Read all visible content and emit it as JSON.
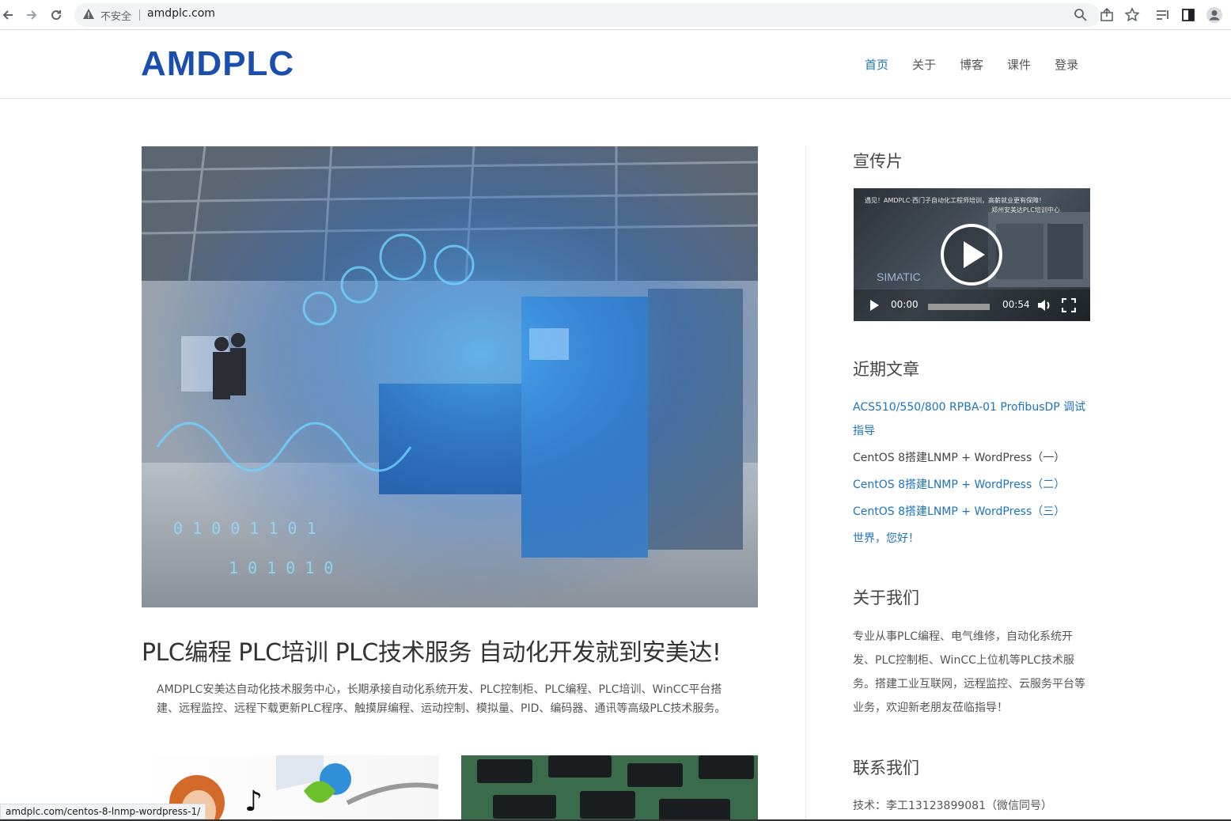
{
  "browser": {
    "security_label": "不安全",
    "url": "amdplc.com",
    "status_url": "amdplc.com/centos-8-lnmp-wordpress-1/"
  },
  "header": {
    "logo": "AMDPLC",
    "menu": [
      "首页",
      "关于",
      "博客",
      "课件",
      "登录"
    ]
  },
  "main": {
    "post_title": "PLC编程 PLC培训 PLC技术服务 自动化开发就到安美达!",
    "post_excerpt": "AMDPLC安美达自动化技术服务中心，长期承接自动化系统开发、PLC控制柜、PLC编程、PLC培训、WinCC平台搭建、远程监控、远程下载更新PLC程序、触摸屏编程、运动控制、模拟量、PID、编码器、通讯等高级PLC技术服务。"
  },
  "sidebar": {
    "video_title": "宣传片",
    "video": {
      "caption_line1": "遇见！AMDPLC·西门子自动化工程师培训，高薪就业更有保障！",
      "caption_line2": "郑州安美达PLC培训中心",
      "brand": "SIMATIC",
      "current_time": "00:00",
      "duration": "00:54"
    },
    "recent_title": "近期文章",
    "recent_posts": [
      "ACS510/550/800 RPBA-01 ProfibusDP 调试指导",
      "CentOS 8搭建LNMP + WordPress（一）",
      "CentOS 8搭建LNMP + WordPress（二）",
      "CentOS 8搭建LNMP + WordPress（三）",
      "世界，您好！"
    ],
    "about_title": "关于我们",
    "about_text": "专业从事PLC编程、电气维修，自动化系统开发、PLC控制柜、WinCC上位机等PLC技术服务。搭建工业互联网，远程监控、云服务平台等业务，欢迎新老朋友莅临指导！",
    "contact_title": "联系我们",
    "contact_line": "技术：李工13123899081（微信同号）"
  },
  "colors": {
    "accent": "#1e73be",
    "logo": "#1a4fae"
  }
}
